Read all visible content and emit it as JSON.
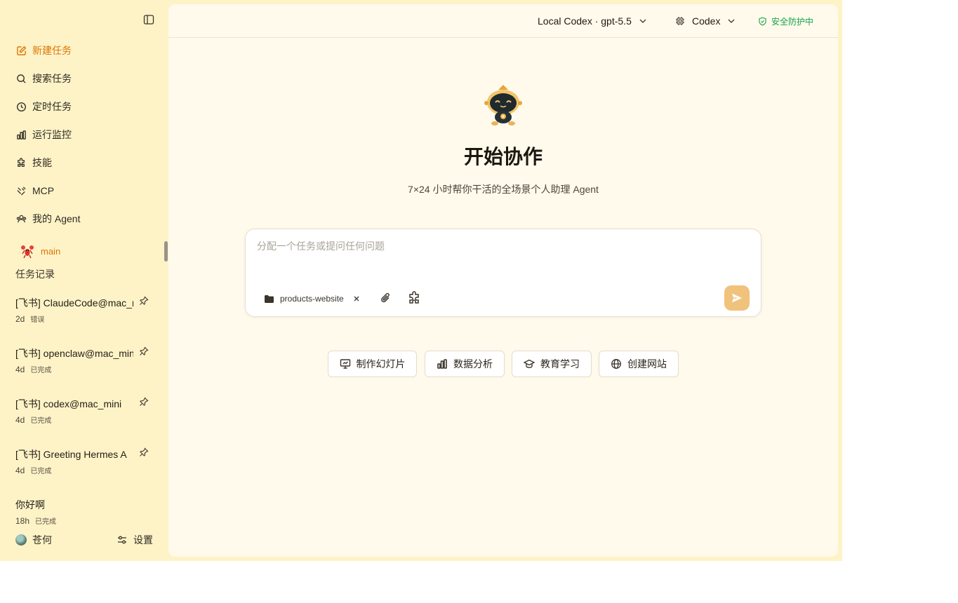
{
  "sidebar": {
    "nav": [
      {
        "label": "新建任务",
        "icon": "edit-icon",
        "active": true
      },
      {
        "label": "搜索任务",
        "icon": "search-icon"
      },
      {
        "label": "定时任务",
        "icon": "clock-icon"
      },
      {
        "label": "运行监控",
        "icon": "bar-chart-icon"
      },
      {
        "label": "技能",
        "icon": "puzzle-icon"
      },
      {
        "label": "MCP",
        "icon": "plug-icon"
      },
      {
        "label": "我的 Agent",
        "icon": "agents-icon"
      }
    ],
    "agent": {
      "label": "main",
      "icon": "lobster-icon"
    },
    "history_title": "任务记录",
    "tasks": [
      {
        "title": "[飞书] ClaudeCode@mac_mini",
        "age": "2d",
        "status": "错误",
        "pinned": true
      },
      {
        "title": "[飞书] openclaw@mac_mini",
        "age": "4d",
        "status": "已完成",
        "pinned": true
      },
      {
        "title": "[飞书] codex@mac_mini",
        "age": "4d",
        "status": "已完成",
        "pinned": true
      },
      {
        "title": "[飞书] Greeting Hermes A",
        "age": "4d",
        "status": "已完成",
        "pinned": true
      },
      {
        "title": "你好啊",
        "age": "18h",
        "status": "已完成",
        "pinned": false
      }
    ],
    "user": {
      "name": "苍何"
    },
    "settings_label": "设置"
  },
  "topbar": {
    "model": "Local Codex · gpt-5.5",
    "engine": "Codex",
    "security": "安全防护中"
  },
  "hero": {
    "title": "开始协作",
    "subtitle": "7×24 小时帮你干活的全场景个人助理 Agent"
  },
  "composer": {
    "placeholder": "分配一个任务或提问任何问题",
    "value": "",
    "folder": "products-website"
  },
  "quick_actions": [
    {
      "label": "制作幻灯片",
      "icon": "presentation-icon"
    },
    {
      "label": "数据分析",
      "icon": "bar-chart-icon"
    },
    {
      "label": "教育学习",
      "icon": "graduation-cap-icon"
    },
    {
      "label": "创建网站",
      "icon": "globe-icon"
    }
  ],
  "colors": {
    "sidebar_bg": "#fef3c7",
    "main_bg": "#fffaeb",
    "accent": "#d97706",
    "secure_green": "#16a34a",
    "send_button": "#f0c27c"
  }
}
